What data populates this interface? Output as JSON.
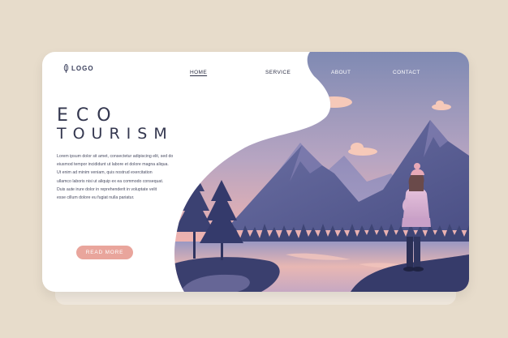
{
  "brand": {
    "logo_text": "LOGO"
  },
  "nav": {
    "items": [
      "HOME",
      "SERVICE",
      "ABOUT",
      "CONTACT"
    ],
    "active": "HOME"
  },
  "hero": {
    "title_line1": "ECO",
    "title_line2": "TOURISM",
    "body_lines": [
      "Lorem ipsum dolor sit amet, consectetur adipiscing elit, sed do",
      "eiusmod tempor incididunt ut labore et dolore magna aliqua.",
      "Ut enim ad minim veniam, quis nostrud exercitation",
      "ullamco laboris nisi ut aliquip ex ea commodo consequat.",
      "Duis aute irure dolor in reprehenderit in voluptate velit",
      "esse cillum dolore eu fugiat nulla pariatur."
    ],
    "cta_label": "READ MORE"
  },
  "colors": {
    "page_background": "#e7dccb",
    "card": "#ffffff",
    "heading": "#34374f",
    "button": "#e9a59c",
    "sky_top": "#7f8ab3",
    "sky_bottom": "#f1b3ae",
    "mountain": "#5a5f92",
    "forest": "#3e4575"
  }
}
